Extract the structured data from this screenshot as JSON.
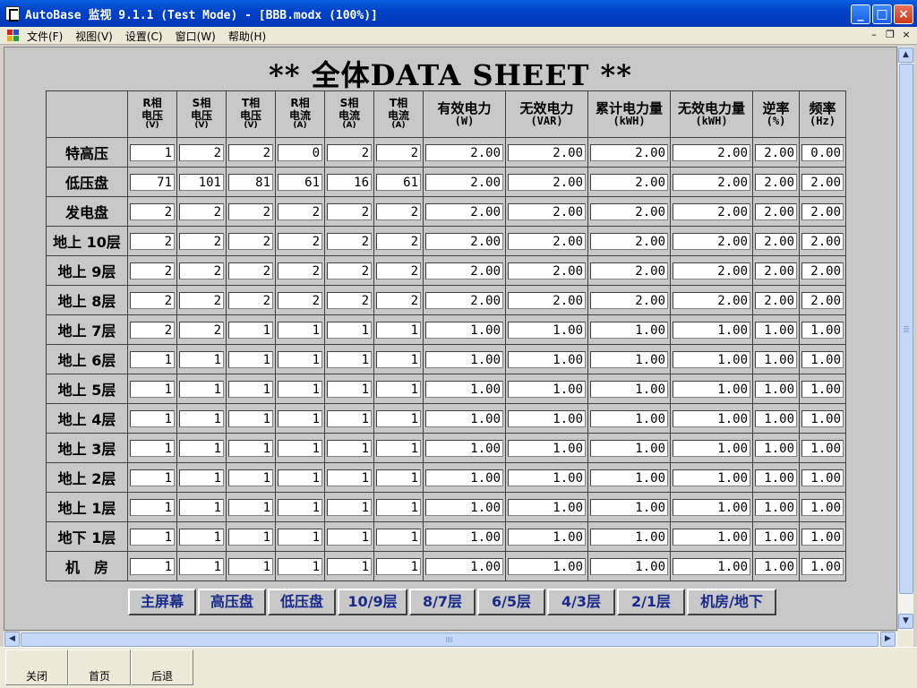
{
  "window": {
    "title": "AutoBase 监视 9.1.1 (Test Mode) - [BBB.modx (100%)]",
    "minimize": "_",
    "maximize": "□",
    "close": "×"
  },
  "menu": {
    "items": [
      "文件(F)",
      "视图(V)",
      "设置(C)",
      "窗口(W)",
      "帮助(H)"
    ],
    "mdi_min": "–",
    "mdi_restore": "❐",
    "mdi_close": "×"
  },
  "sheet": {
    "heading": "** 全体DATA SHEET **",
    "columns": [
      {
        "l1": "R相",
        "l2": "电压",
        "u": "(V)"
      },
      {
        "l1": "S相",
        "l2": "电压",
        "u": "(V)"
      },
      {
        "l1": "T相",
        "l2": "电压",
        "u": "(V)"
      },
      {
        "l1": "R相",
        "l2": "电流",
        "u": "(A)"
      },
      {
        "l1": "S相",
        "l2": "电流",
        "u": "(A)"
      },
      {
        "l1": "T相",
        "l2": "电流",
        "u": "(A)"
      },
      {
        "l1": "有效电力",
        "u": "(W)"
      },
      {
        "l1": "无效电力",
        "u": "(VAR)"
      },
      {
        "l1": "累计电力量",
        "u": "(kWH)"
      },
      {
        "l1": "无效电力量",
        "u": "(kWH)"
      },
      {
        "l1": "逆率",
        "u": "(%)"
      },
      {
        "l1": "频率",
        "u": "(Hz)"
      }
    ],
    "rows": [
      {
        "label": "特高压",
        "values": [
          "1",
          "2",
          "2",
          "0",
          "2",
          "2",
          "2.00",
          "2.00",
          "2.00",
          "2.00",
          "2.00",
          "0.00"
        ]
      },
      {
        "label": "低压盘",
        "values": [
          "71",
          "101",
          "81",
          "61",
          "16",
          "61",
          "2.00",
          "2.00",
          "2.00",
          "2.00",
          "2.00",
          "2.00"
        ]
      },
      {
        "label": "发电盘",
        "values": [
          "2",
          "2",
          "2",
          "2",
          "2",
          "2",
          "2.00",
          "2.00",
          "2.00",
          "2.00",
          "2.00",
          "2.00"
        ]
      },
      {
        "label": "地上 10层",
        "values": [
          "2",
          "2",
          "2",
          "2",
          "2",
          "2",
          "2.00",
          "2.00",
          "2.00",
          "2.00",
          "2.00",
          "2.00"
        ]
      },
      {
        "label": "地上 9层",
        "values": [
          "2",
          "2",
          "2",
          "2",
          "2",
          "2",
          "2.00",
          "2.00",
          "2.00",
          "2.00",
          "2.00",
          "2.00"
        ]
      },
      {
        "label": "地上 8层",
        "values": [
          "2",
          "2",
          "2",
          "2",
          "2",
          "2",
          "2.00",
          "2.00",
          "2.00",
          "2.00",
          "2.00",
          "2.00"
        ]
      },
      {
        "label": "地上 7层",
        "values": [
          "2",
          "2",
          "1",
          "1",
          "1",
          "1",
          "1.00",
          "1.00",
          "1.00",
          "1.00",
          "1.00",
          "1.00"
        ]
      },
      {
        "label": "地上 6层",
        "values": [
          "1",
          "1",
          "1",
          "1",
          "1",
          "1",
          "1.00",
          "1.00",
          "1.00",
          "1.00",
          "1.00",
          "1.00"
        ]
      },
      {
        "label": "地上 5层",
        "values": [
          "1",
          "1",
          "1",
          "1",
          "1",
          "1",
          "1.00",
          "1.00",
          "1.00",
          "1.00",
          "1.00",
          "1.00"
        ]
      },
      {
        "label": "地上 4层",
        "values": [
          "1",
          "1",
          "1",
          "1",
          "1",
          "1",
          "1.00",
          "1.00",
          "1.00",
          "1.00",
          "1.00",
          "1.00"
        ]
      },
      {
        "label": "地上 3层",
        "values": [
          "1",
          "1",
          "1",
          "1",
          "1",
          "1",
          "1.00",
          "1.00",
          "1.00",
          "1.00",
          "1.00",
          "1.00"
        ]
      },
      {
        "label": "地上 2层",
        "values": [
          "1",
          "1",
          "1",
          "1",
          "1",
          "1",
          "1.00",
          "1.00",
          "1.00",
          "1.00",
          "1.00",
          "1.00"
        ]
      },
      {
        "label": "地上 1层",
        "values": [
          "1",
          "1",
          "1",
          "1",
          "1",
          "1",
          "1.00",
          "1.00",
          "1.00",
          "1.00",
          "1.00",
          "1.00"
        ]
      },
      {
        "label": "地下 1层",
        "values": [
          "1",
          "1",
          "1",
          "1",
          "1",
          "1",
          "1.00",
          "1.00",
          "1.00",
          "1.00",
          "1.00",
          "1.00"
        ]
      },
      {
        "label": "机　房",
        "values": [
          "1",
          "1",
          "1",
          "1",
          "1",
          "1",
          "1.00",
          "1.00",
          "1.00",
          "1.00",
          "1.00",
          "1.00"
        ]
      }
    ]
  },
  "nav": [
    "主屏幕",
    "高压盘",
    "低压盘",
    "10/9层",
    "8/7层",
    "6/5层",
    "4/3层",
    "2/1层",
    "机房/地下"
  ],
  "bottom": {
    "close": "关闭",
    "home": "首页",
    "back": "后退"
  },
  "scroll": {
    "up": "▲",
    "down": "▼",
    "left": "◀",
    "right": "▶"
  }
}
